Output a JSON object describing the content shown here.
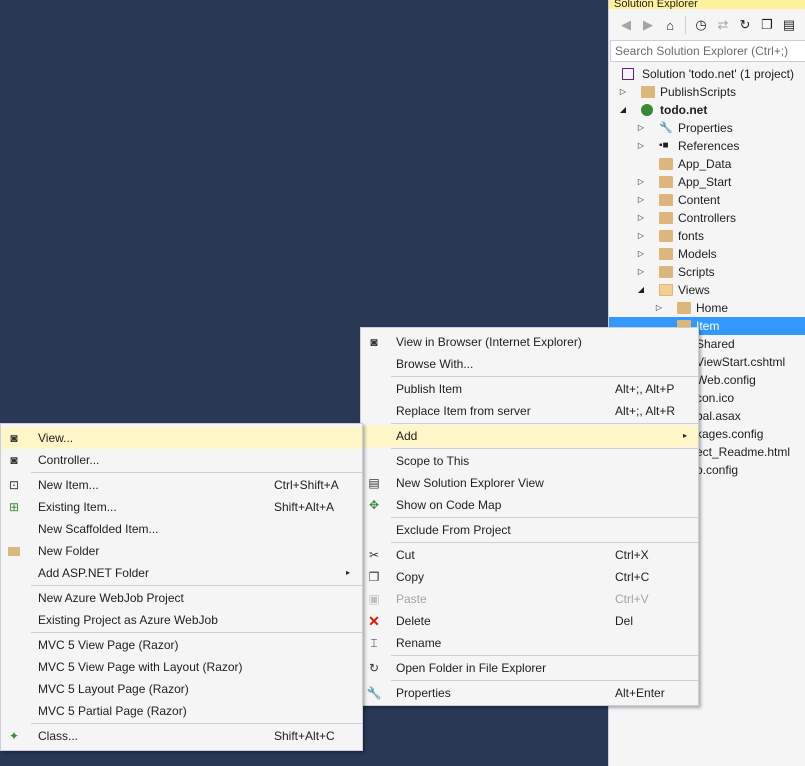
{
  "solution_explorer": {
    "title": "Solution Explorer",
    "search_placeholder": "Search Solution Explorer (Ctrl+;)",
    "tree": [
      {
        "label": "Solution 'todo.net' (1 project)",
        "icon": "solution-icon"
      },
      {
        "label": "PublishScripts",
        "icon": "folder-icon"
      },
      {
        "label": "todo.net",
        "icon": "web-project-icon"
      },
      {
        "label": "Properties",
        "icon": "wrench-icon"
      },
      {
        "label": "References",
        "icon": "references-icon"
      },
      {
        "label": "App_Data",
        "icon": "folder-icon"
      },
      {
        "label": "App_Start",
        "icon": "folder-icon"
      },
      {
        "label": "Content",
        "icon": "folder-icon"
      },
      {
        "label": "Controllers",
        "icon": "folder-icon"
      },
      {
        "label": "fonts",
        "icon": "folder-icon"
      },
      {
        "label": "Models",
        "icon": "folder-icon"
      },
      {
        "label": "Scripts",
        "icon": "folder-icon"
      },
      {
        "label": "Views",
        "icon": "folder-open-icon"
      },
      {
        "label": "Home",
        "icon": "folder-icon"
      },
      {
        "label": "Item",
        "icon": "folder-icon"
      },
      {
        "label": "Shared",
        "icon": "folder-icon"
      },
      {
        "label": "ViewStart.cshtml",
        "icon": "file-icon"
      },
      {
        "label": "Web.config",
        "icon": "file-icon"
      },
      {
        "label": "con.ico",
        "icon": "file-icon"
      },
      {
        "label": "bal.asax",
        "icon": "file-icon"
      },
      {
        "label": "kages.config",
        "icon": "file-icon"
      },
      {
        "label": "ect_Readme.html",
        "icon": "file-icon"
      },
      {
        "label": "o.config",
        "icon": "file-icon"
      }
    ]
  },
  "context_menu": {
    "items": [
      {
        "label": "View in Browser (Internet Explorer)",
        "icon": "browser-icon"
      },
      {
        "label": "Browse With..."
      },
      {
        "label": "Publish Item",
        "shortcut": "Alt+;, Alt+P"
      },
      {
        "label": "Replace Item from server",
        "shortcut": "Alt+;, Alt+R"
      },
      {
        "label": "Add",
        "submenu": "▸"
      },
      {
        "label": "Scope to This"
      },
      {
        "label": "New Solution Explorer View",
        "icon": "new-view-icon"
      },
      {
        "label": "Show on Code Map",
        "icon": "code-map-icon"
      },
      {
        "label": "Exclude From Project"
      },
      {
        "label": "Cut",
        "shortcut": "Ctrl+X",
        "icon": "scissors-icon"
      },
      {
        "label": "Copy",
        "shortcut": "Ctrl+C",
        "icon": "copy-icon"
      },
      {
        "label": "Paste",
        "shortcut": "Ctrl+V",
        "icon": "paste-icon"
      },
      {
        "label": "Delete",
        "shortcut": "Del",
        "icon": "delete-icon"
      },
      {
        "label": "Rename",
        "icon": "rename-icon"
      },
      {
        "label": "Open Folder in File Explorer",
        "icon": "refresh-icon"
      },
      {
        "label": "Properties",
        "shortcut": "Alt+Enter",
        "icon": "wrench-icon"
      }
    ]
  },
  "add_submenu": {
    "items": [
      {
        "label": "View...",
        "icon": "view-icon"
      },
      {
        "label": "Controller...",
        "icon": "controller-icon"
      },
      {
        "label": "New Item...",
        "shortcut": "Ctrl+Shift+A",
        "icon": "new-item-icon"
      },
      {
        "label": "Existing Item...",
        "shortcut": "Shift+Alt+A",
        "icon": "existing-item-icon"
      },
      {
        "label": "New Scaffolded Item..."
      },
      {
        "label": "New Folder",
        "icon": "new-folder-icon"
      },
      {
        "label": "Add ASP.NET Folder",
        "submenu": "▸"
      },
      {
        "label": "New Azure WebJob Project"
      },
      {
        "label": "Existing Project as Azure WebJob"
      },
      {
        "label": "MVC 5 View Page (Razor)"
      },
      {
        "label": "MVC 5 View Page with Layout (Razor)"
      },
      {
        "label": "MVC 5 Layout Page (Razor)"
      },
      {
        "label": "MVC 5 Partial Page (Razor)"
      },
      {
        "label": "Class...",
        "shortcut": "Shift+Alt+C",
        "icon": "class-icon"
      }
    ]
  }
}
